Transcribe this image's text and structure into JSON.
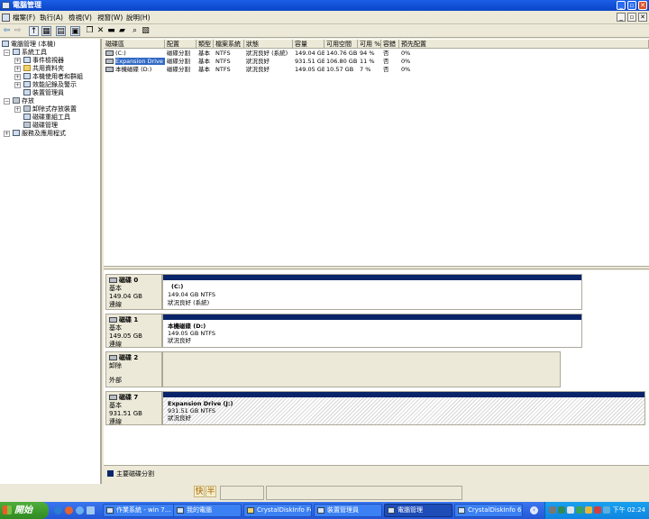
{
  "window": {
    "title": "電腦管理"
  },
  "menu": [
    "檔案(F)",
    "執行(A)",
    "檢視(V)",
    "視窗(W)",
    "說明(H)"
  ],
  "tree": {
    "root": "電腦管理 (本機)",
    "system_tools": "系統工具",
    "event_viewer": "事件檢視器",
    "shared_folders": "共用資料夾",
    "local_users": "本機使用者和群組",
    "perf_logs": "效能記錄及警示",
    "device_manager": "裝置管理員",
    "storage": "存放",
    "removable": "卸除式存放裝置",
    "defrag": "磁碟重組工具",
    "disk_mgmt": "磁碟管理",
    "services": "服務及應用程式"
  },
  "volume_table": {
    "headers": [
      "磁碟區",
      "配置",
      "類型",
      "檔案系統",
      "狀態",
      "容量",
      "可用空間",
      "可用 %",
      "容錯",
      "預先配置"
    ],
    "rows": [
      [
        "(C:)",
        "磁碟分割",
        "基本",
        "NTFS",
        "狀況良好 (系統)",
        "149.04 GB",
        "140.76 GB",
        "94 %",
        "否",
        "0%"
      ],
      [
        "Expansion Drive (J:)",
        "磁碟分割",
        "基本",
        "NTFS",
        "狀況良好",
        "931.51 GB",
        "106.80 GB",
        "11 %",
        "否",
        "0%"
      ],
      [
        "本機磁碟 (D:)",
        "磁碟分割",
        "基本",
        "NTFS",
        "狀況良好",
        "149.05 GB",
        "10.57 GB",
        "7 %",
        "否",
        "0%"
      ]
    ]
  },
  "disks": [
    {
      "name": "磁碟 0",
      "type": "基本",
      "size": "149.04 GB",
      "status": "連線",
      "part_name": "(C:)",
      "part_size": "149.04 GB NTFS",
      "part_status": "狀況良好 (系統)"
    },
    {
      "name": "磁碟 1",
      "type": "基本",
      "size": "149.05 GB",
      "status": "連線",
      "part_name": "本機磁碟  (D:)",
      "part_size": "149.05 GB NTFS",
      "part_status": "狀況良好"
    },
    {
      "name": "磁碟 2",
      "type": "卸除",
      "size": "",
      "status": "",
      "part_name": "",
      "part_size": "",
      "part_status": "",
      "extra": "外部"
    },
    {
      "name": "磁碟 7",
      "type": "基本",
      "size": "931.51 GB",
      "status": "連線",
      "part_name": "Expansion Drive  (J:)",
      "part_size": "931.51 GB NTFS",
      "part_status": "狀況良好"
    }
  ],
  "legend": {
    "primary_label": "主要磁碟分割",
    "primary_color": "#0a246a"
  },
  "status_bar": {
    "ime1": "快",
    "ime2": "半"
  },
  "taskbar": {
    "start": "開始",
    "tasks": [
      "作業系統 - win 7...",
      "我的電腦",
      "CrystalDiskInfo Fo...",
      "裝置管理員",
      "電腦管理",
      "CrystalDiskInfo 6...."
    ],
    "clock": "下午 02:24"
  }
}
